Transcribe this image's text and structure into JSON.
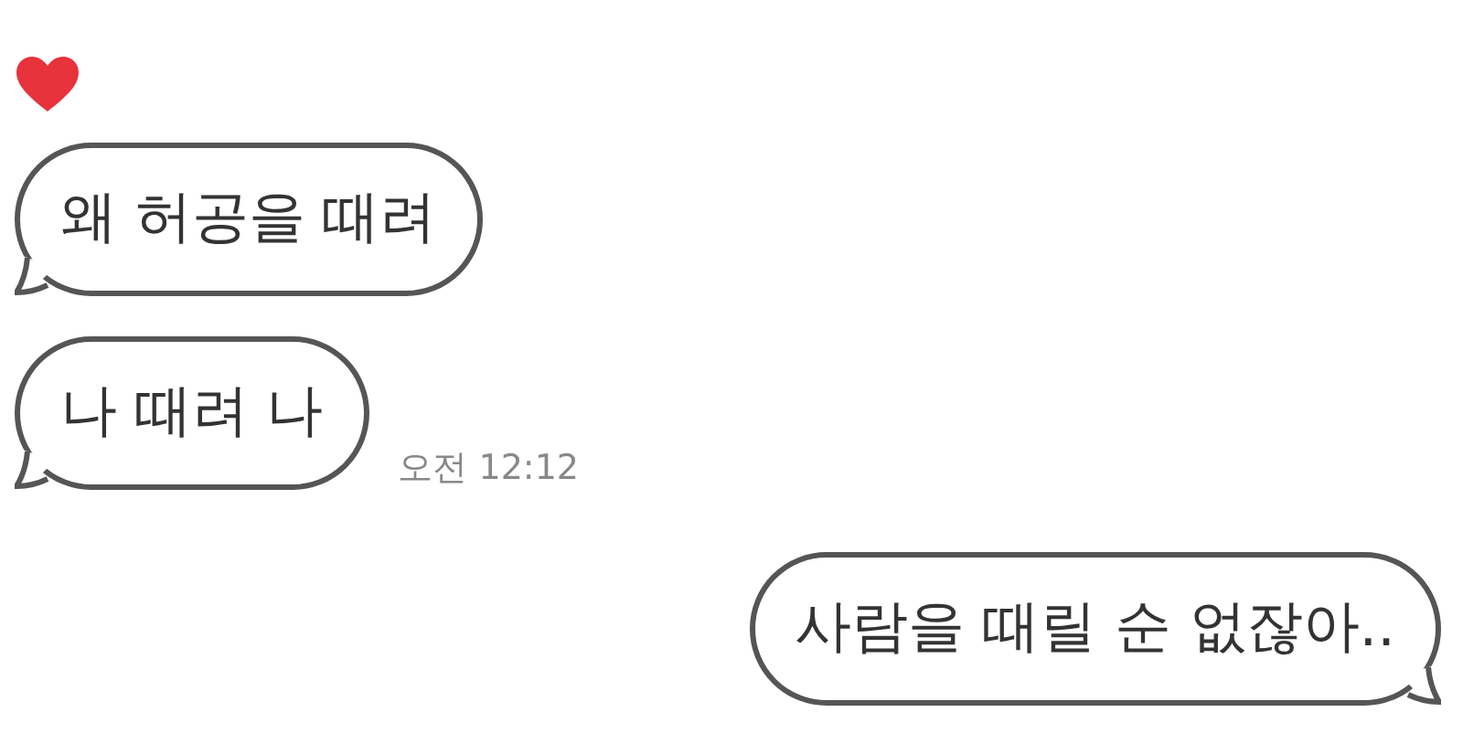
{
  "messages": [
    {
      "kind": "incoming",
      "text": "왜 허공을 때려",
      "reacted": true
    },
    {
      "kind": "incoming",
      "text": "나 때려 나",
      "time": "오전 12:12",
      "reacted": false
    },
    {
      "kind": "outgoing",
      "text": "사람을 때릴 순 없잖아..",
      "reacted": false
    }
  ]
}
